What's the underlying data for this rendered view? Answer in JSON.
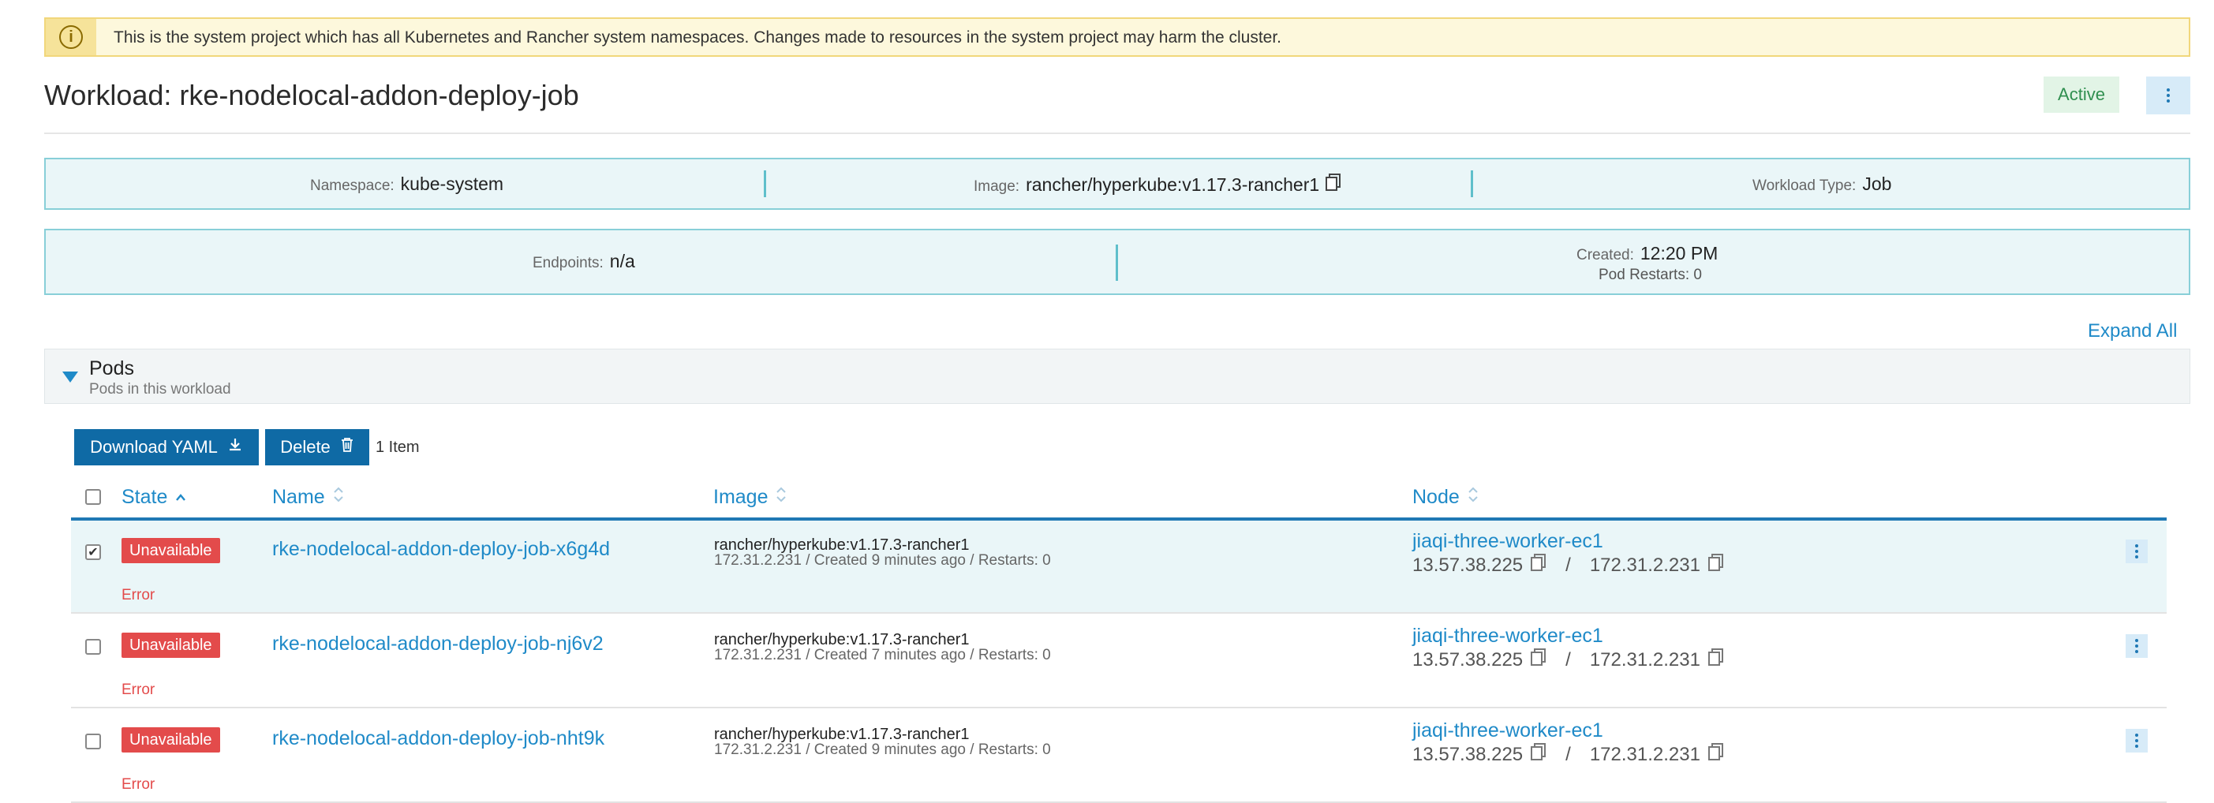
{
  "banner": {
    "text": "This is the system project which has all Kubernetes and Rancher system namespaces. Changes made to resources in the system project may harm the cluster."
  },
  "header": {
    "title": "Workload: rke-nodelocal-addon-deploy-job",
    "status": "Active"
  },
  "info": {
    "namespace_label": "Namespace:",
    "namespace": "kube-system",
    "image_label": "Image:",
    "image": "rancher/hyperkube:v1.17.3-rancher1",
    "type_label": "Workload Type:",
    "type": "Job",
    "endpoints_label": "Endpoints:",
    "endpoints": "n/a",
    "created_label": "Created:",
    "created": "12:20 PM",
    "restarts": "Pod Restarts: 0"
  },
  "expand_all": "Expand All",
  "pods": {
    "title": "Pods",
    "subtitle": "Pods in this workload",
    "download_label": "Download YAML",
    "delete_label": "Delete",
    "count": "1 Item",
    "columns": {
      "state": "State",
      "name": "Name",
      "image": "Image",
      "node": "Node"
    },
    "rows": [
      {
        "state": "Unavailable",
        "error": "Error",
        "name": "rke-nodelocal-addon-deploy-job-x6g4d",
        "image": "rancher/hyperkube:v1.17.3-rancher1",
        "detail": "172.31.2.231 / Created 9 minutes ago / Restarts: 0",
        "node": "jiaqi-three-worker-ec1",
        "ip_public": "13.57.38.225",
        "ip_sep": "/",
        "ip_private": "172.31.2.231",
        "checked": true
      },
      {
        "state": "Unavailable",
        "error": "Error",
        "name": "rke-nodelocal-addon-deploy-job-nj6v2",
        "image": "rancher/hyperkube:v1.17.3-rancher1",
        "detail": "172.31.2.231 / Created 7 minutes ago / Restarts: 0",
        "node": "jiaqi-three-worker-ec1",
        "ip_public": "13.57.38.225",
        "ip_sep": "/",
        "ip_private": "172.31.2.231",
        "checked": false
      },
      {
        "state": "Unavailable",
        "error": "Error",
        "name": "rke-nodelocal-addon-deploy-job-nht9k",
        "image": "rancher/hyperkube:v1.17.3-rancher1",
        "detail": "172.31.2.231 / Created 9 minutes ago / Restarts: 0",
        "node": "jiaqi-three-worker-ec1",
        "ip_public": "13.57.38.225",
        "ip_sep": "/",
        "ip_private": "172.31.2.231",
        "checked": false
      }
    ]
  },
  "icons": {
    "banner": "info-icon",
    "copy": "clipboard-icon",
    "download": "download-icon",
    "delete": "trash-icon",
    "sort": "sort-icon",
    "menu": "kebab-menu-icon"
  },
  "colors": {
    "accent": "#1f8ac8",
    "button": "#0f6aa5",
    "error": "#e34b4b",
    "active": "#2f8f4f",
    "warning_bg": "#fdf8dc"
  }
}
